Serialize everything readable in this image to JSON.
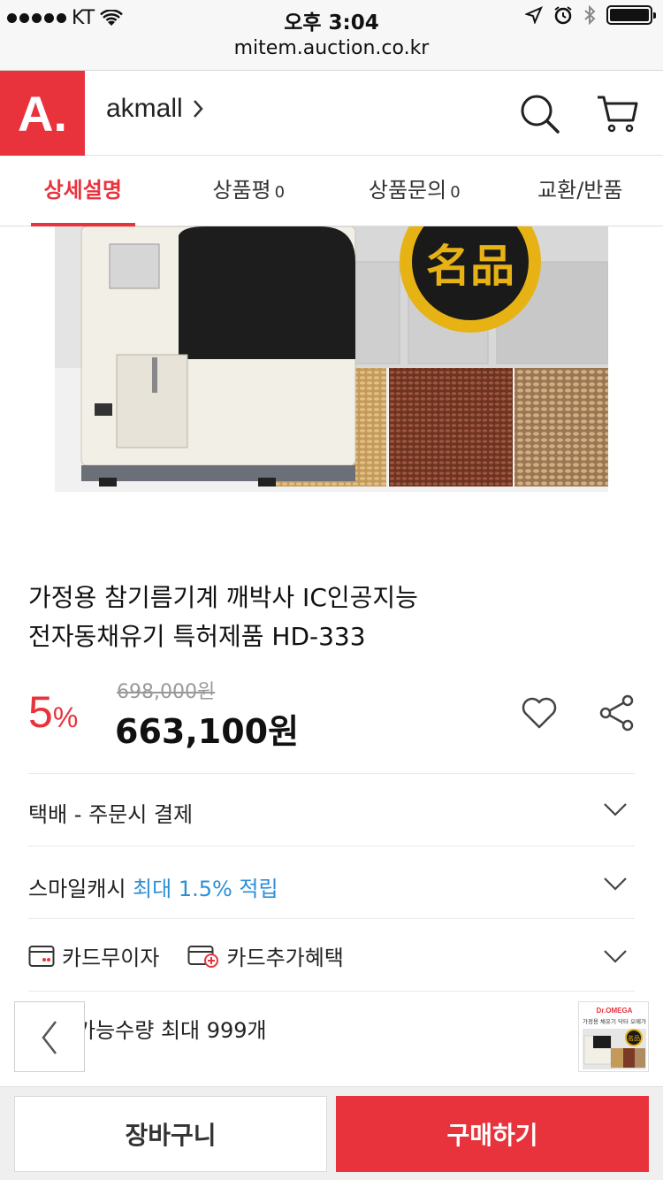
{
  "status": {
    "carrier": "KT",
    "time": "오후 3:04"
  },
  "url": "mitem.auction.co.kr",
  "header": {
    "logo": "A.",
    "shop_name": "akmall",
    "shop_chevron": "›"
  },
  "tabs": [
    {
      "label": "상세설명",
      "count": ""
    },
    {
      "label": "상품평",
      "count": "0"
    },
    {
      "label": "상품문의",
      "count": "0"
    },
    {
      "label": "교환/반품",
      "count": ""
    }
  ],
  "product": {
    "badge_text": "名品",
    "title_line1": "가정용 참기름기계 깨박사 IC인공지능",
    "title_line2": "전자동채유기 특허제품 HD-333",
    "original_price": "698,000원",
    "discount_value": "5",
    "discount_unit": "%",
    "sale_price": "663,100원"
  },
  "options": {
    "delivery": "택배 - 주문시 결제",
    "smile_label": "스마일캐시",
    "smile_highlight": "최대 1.5% 적립",
    "card_interest": "카드무이자",
    "card_benefit": "카드추가혜택",
    "quantity": "가능수량 최대 999개"
  },
  "thumbnail": {
    "brand": "Dr.OMEGA",
    "caption": "가정용 채유기 닥터 오메가",
    "badge": "名品"
  },
  "buttons": {
    "cart": "장바구니",
    "buy": "구매하기"
  },
  "colors": {
    "accent": "#e8333d",
    "link_blue": "#2d8fd6"
  }
}
